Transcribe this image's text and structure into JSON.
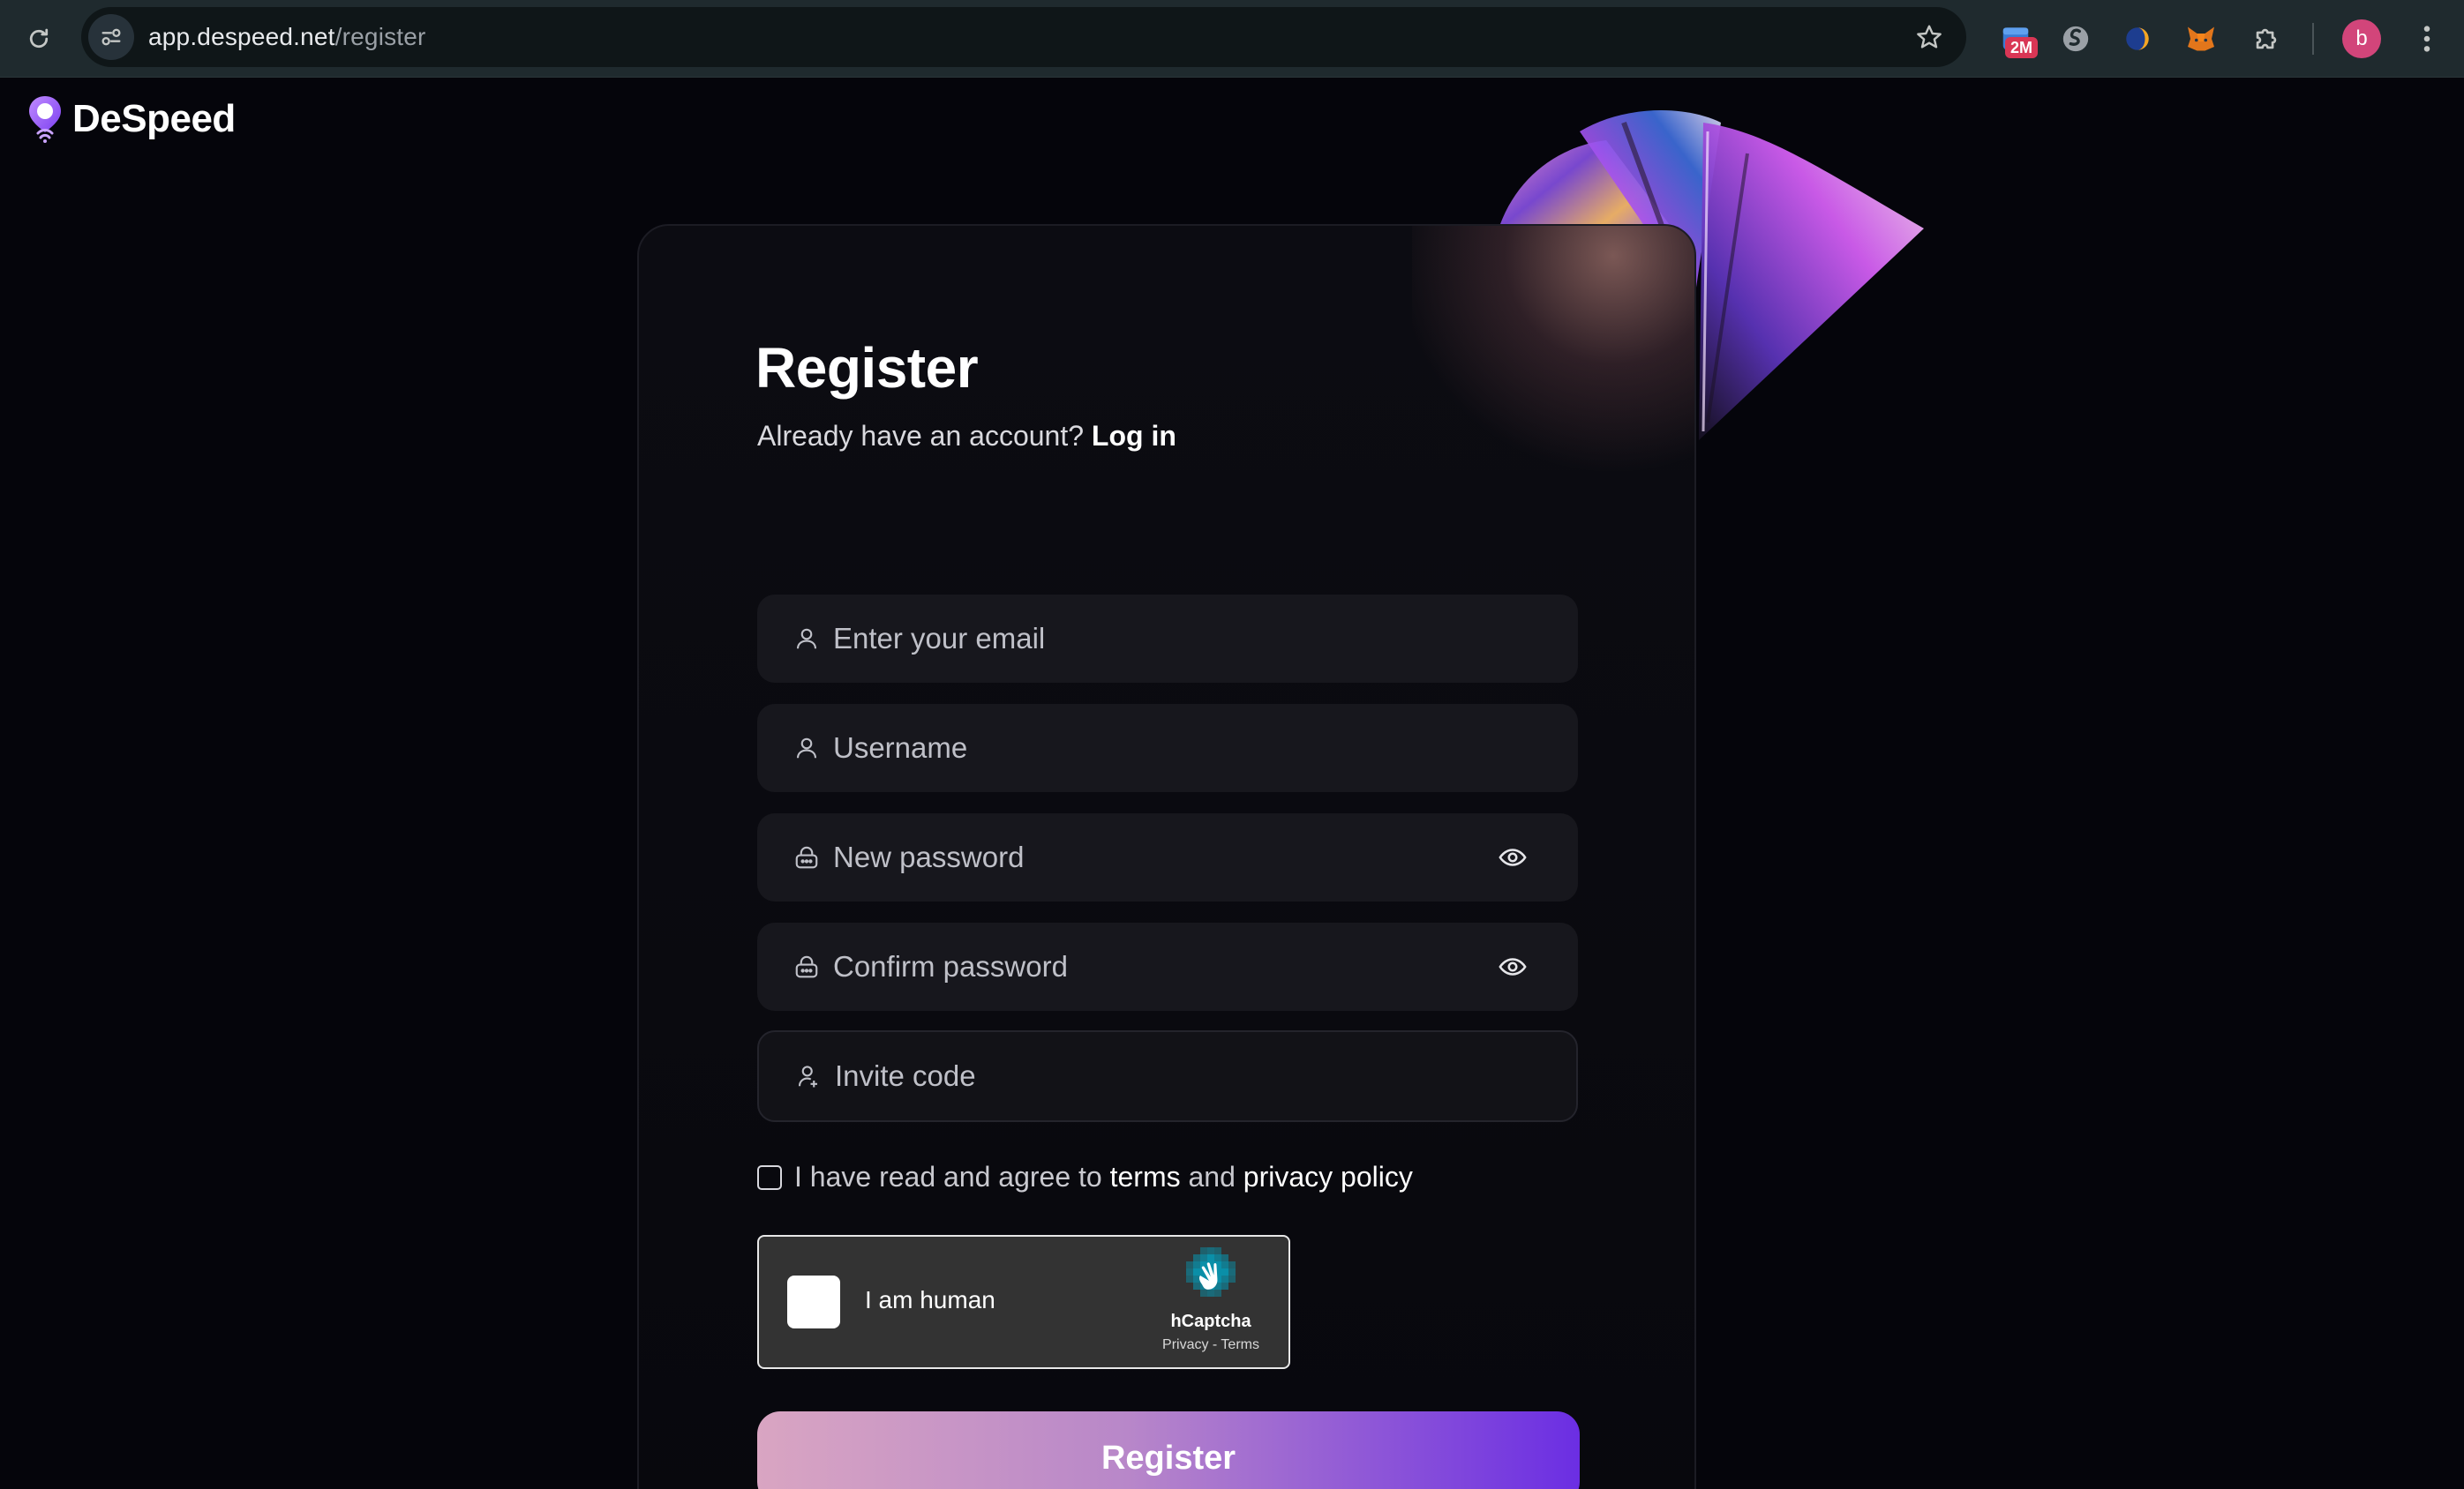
{
  "browser": {
    "url_host": "app.despeed.net",
    "url_path": "/register",
    "extension_badge": "2M",
    "profile_initial": "b",
    "icons": [
      "reload-icon",
      "site-info-icon",
      "bookmark-star-icon",
      "extension-calendar-icon",
      "extension-s-icon",
      "extension-moon-icon",
      "extension-fox-icon",
      "extensions-puzzle-icon",
      "chrome-menu-icon"
    ]
  },
  "header": {
    "logo_text": "DeSpeed"
  },
  "register": {
    "title": "Register",
    "subtitle_prefix": "Already have an account?",
    "login_link": "Log in",
    "fields": {
      "email_placeholder": "Enter your email",
      "username_placeholder": "Username",
      "new_password_placeholder": "New password",
      "confirm_password_placeholder": "Confirm password",
      "invite_code_placeholder": "Invite code"
    },
    "agree_prefix": "I have read and agree to",
    "terms_link": "terms",
    "agree_and": "and",
    "privacy_link": "privacy policy",
    "captcha": {
      "label": "I am human",
      "brand": "hCaptcha",
      "links": "Privacy - Terms"
    },
    "submit_label": "Register"
  },
  "colors": {
    "background": "#05050b",
    "card": "#0c0c12",
    "field": "#17171d",
    "button_gradient_start": "#d9a5c2",
    "button_gradient_end": "#6b2ee3"
  }
}
